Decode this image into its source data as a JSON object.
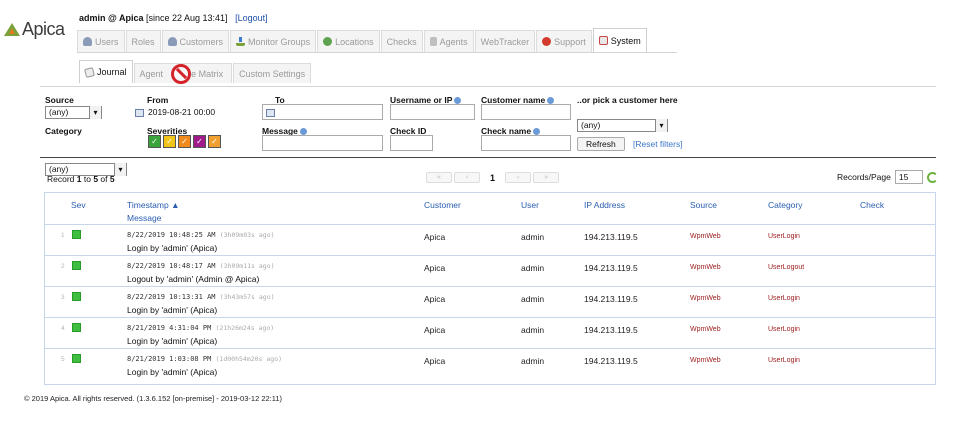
{
  "brand": {
    "logo_text": "Apica"
  },
  "userline": {
    "user": "admin @ Apica",
    "since": "[since 22 Aug 13:41]",
    "logout": "[Logout]"
  },
  "tabs": [
    {
      "label": "Users",
      "icon": "person-icon"
    },
    {
      "label": "Roles",
      "icon": ""
    },
    {
      "label": "Customers",
      "icon": "person-icon"
    },
    {
      "label": "Monitor Groups",
      "icon": "network-icon"
    },
    {
      "label": "Locations",
      "icon": "globe-icon"
    },
    {
      "label": "Checks",
      "icon": ""
    },
    {
      "label": "Agents",
      "icon": "agent-icon"
    },
    {
      "label": "WebTracker",
      "icon": ""
    },
    {
      "label": "Support",
      "icon": "support-icon"
    },
    {
      "label": "System",
      "icon": "system-icon",
      "active": true
    }
  ],
  "subtabs": [
    {
      "label": "Journal",
      "active": true
    },
    {
      "label": "Agent",
      "active": false
    },
    {
      "label": "e Matrix",
      "active": false
    },
    {
      "label": "Custom Settings",
      "active": false
    }
  ],
  "filters": {
    "source_label": "Source",
    "source_value": "(any)",
    "from_label": "From",
    "from_value": "2019-08-21 00:00",
    "to_label": "To",
    "to_value": "",
    "username_label": "Username or IP",
    "username_value": "",
    "customer_name_label": "Customer name",
    "customer_name_value": "",
    "pick_customer_label": "..or pick a customer here",
    "pick_customer_value": "(any)",
    "category_label": "Category",
    "category_value": "(any)",
    "severities_label": "Severities",
    "severities": [
      {
        "name": "ok",
        "color": "#3aa33a"
      },
      {
        "name": "info",
        "color": "#f0c419"
      },
      {
        "name": "warning",
        "color": "#f08a1c"
      },
      {
        "name": "error",
        "color": "#a01a8a"
      },
      {
        "name": "fatal",
        "color": "#f0a030"
      }
    ],
    "message_label": "Message",
    "message_value": "",
    "check_id_label": "Check ID",
    "check_id_value": "",
    "check_name_label": "Check name",
    "check_name_value": "",
    "refresh_button": "Refresh",
    "reset_link": "[Reset filters]"
  },
  "records": {
    "prefix": "Record ",
    "from": "1",
    "mid": " to ",
    "to": "5",
    "of": " of ",
    "total": "5",
    "page": "1",
    "per_page_label": "Records/Page",
    "per_page_value": "15",
    "pager_first": "«",
    "pager_prev": "‹",
    "pager_next": "›",
    "pager_last": "»"
  },
  "table": {
    "columns": {
      "sev": "Sev",
      "timestamp": "Timestamp ▲",
      "message": "Message",
      "customer": "Customer",
      "user": "User",
      "ip": "IP Address",
      "source": "Source",
      "category": "Category",
      "check": "Check"
    },
    "rows": [
      {
        "num": "1",
        "timestamp": "8/22/2019 10:48:25 AM",
        "ago": "(3h09m03s ago)",
        "message": "Login by 'admin' (Apica)",
        "customer": "Apica",
        "user": "admin",
        "ip": "194.213.119.5",
        "source": "WpmWeb",
        "category": "UserLogin",
        "check": ""
      },
      {
        "num": "2",
        "timestamp": "8/22/2019 10:48:17 AM",
        "ago": "(3h09m11s ago)",
        "message": "Logout by 'admin' (Admin @ Apica)",
        "customer": "Apica",
        "user": "admin",
        "ip": "194.213.119.5",
        "source": "WpmWeb",
        "category": "UserLogout",
        "check": ""
      },
      {
        "num": "3",
        "timestamp": "8/22/2019 10:13:31 AM",
        "ago": "(3h43m57s ago)",
        "message": "Login by 'admin' (Apica)",
        "customer": "Apica",
        "user": "admin",
        "ip": "194.213.119.5",
        "source": "WpmWeb",
        "category": "UserLogin",
        "check": ""
      },
      {
        "num": "4",
        "timestamp": "8/21/2019 4:31:04 PM",
        "ago": "(21h26m24s ago)",
        "message": "Login by 'admin' (Apica)",
        "customer": "Apica",
        "user": "admin",
        "ip": "194.213.119.5",
        "source": "WpmWeb",
        "category": "UserLogin",
        "check": ""
      },
      {
        "num": "5",
        "timestamp": "8/21/2019 1:03:08 PM",
        "ago": "(1d00h54m20s ago)",
        "message": "Login by 'admin' (Apica)",
        "customer": "Apica",
        "user": "admin",
        "ip": "194.213.119.5",
        "source": "WpmWeb",
        "category": "UserLogin",
        "check": ""
      }
    ]
  },
  "footer": {
    "text": "© 2019 Apica. All rights reserved. (1.3.6.152 [on-premise] - 2019-03-12 22:11)"
  }
}
